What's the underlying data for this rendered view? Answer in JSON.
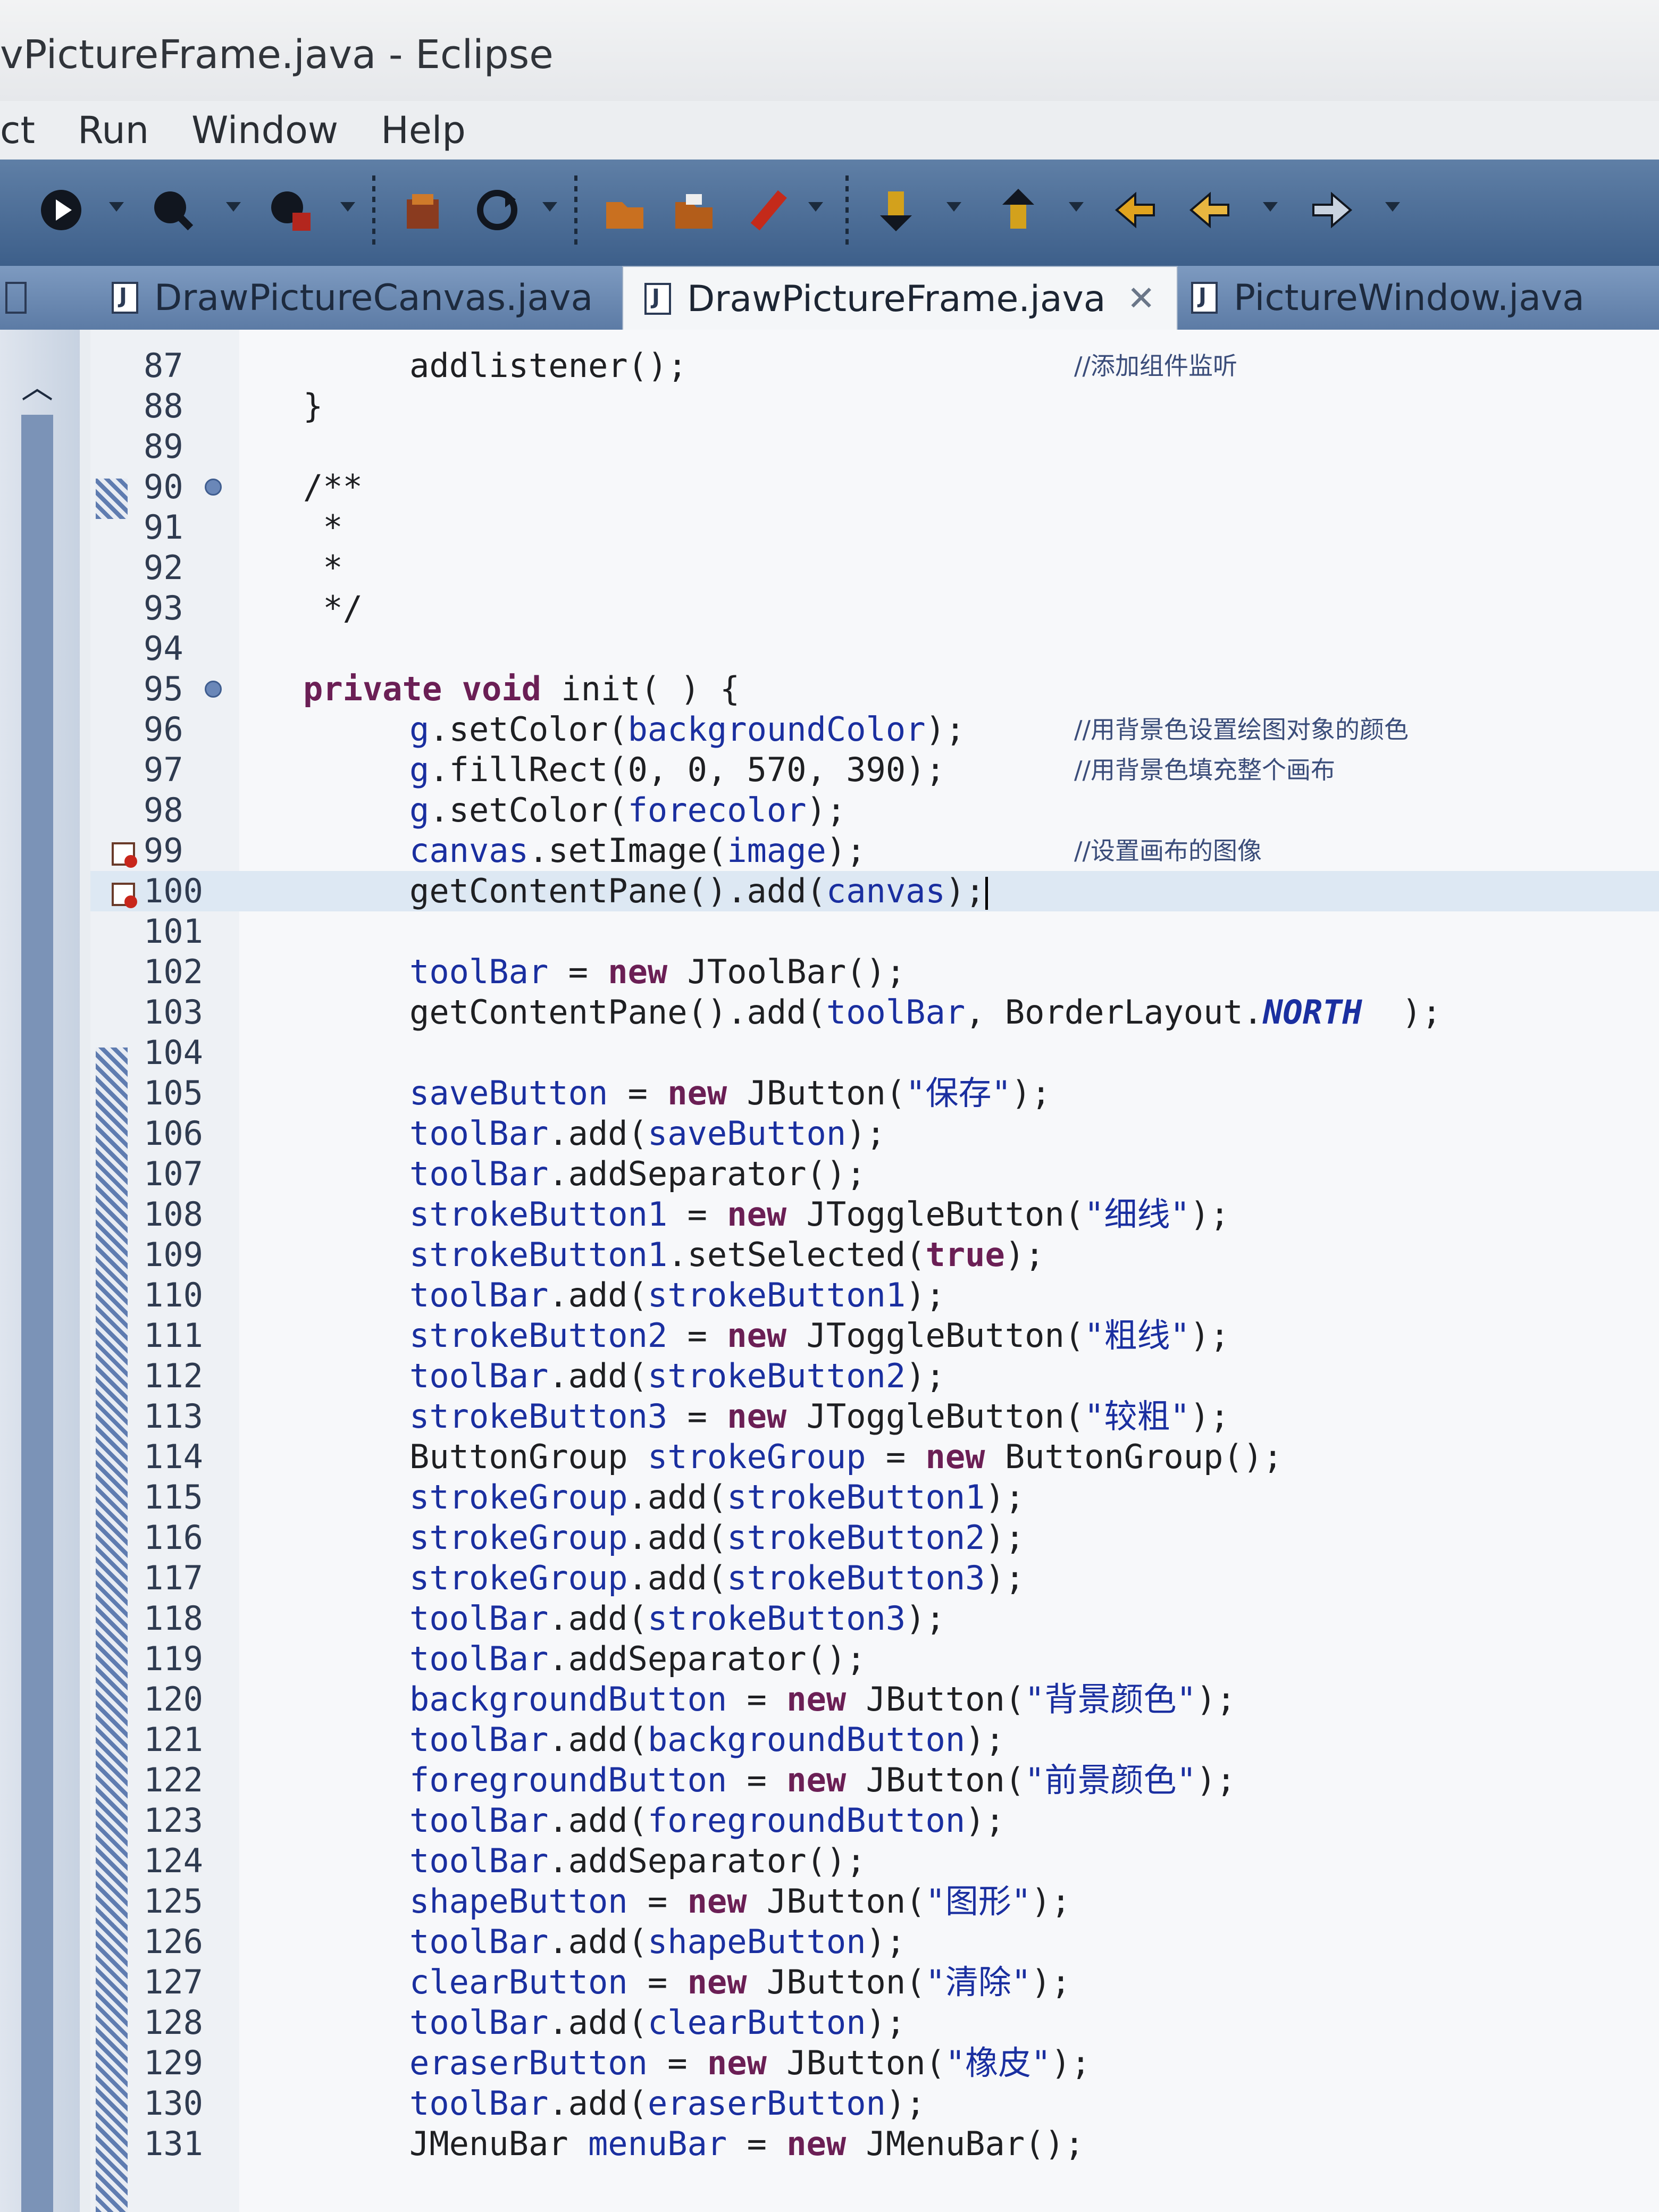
{
  "window": {
    "title": "vPictureFrame.java - Eclipse"
  },
  "menu": {
    "items": [
      "ct",
      "Run",
      "Window",
      "Help"
    ]
  },
  "toolbar": {
    "icons": [
      "debug-icon",
      "run-icon",
      "search-icon",
      "external-tools-icon",
      "new-package-icon",
      "refresh-icon",
      "open-type-icon",
      "open-task-icon",
      "edit-icon",
      "next-annotation-icon",
      "previous-annotation-icon",
      "last-edit-icon",
      "back-icon",
      "forward-icon"
    ]
  },
  "tabs": [
    {
      "label": "DrawPictureCanvas.java",
      "active": false
    },
    {
      "label": "DrawPictureFrame.java",
      "active": true,
      "close": "✕"
    },
    {
      "label": "PictureWindow.java",
      "active": false
    }
  ],
  "editor": {
    "current_line": "100",
    "lines": [
      {
        "num": "87",
        "indent": 1,
        "code": "addlistener();",
        "comment": "//添加组件监听"
      },
      {
        "num": "88",
        "indent": 0,
        "code": "}",
        "comment": ""
      },
      {
        "num": "89",
        "indent": 0,
        "code": "",
        "comment": ""
      },
      {
        "num": "90",
        "indent": 0,
        "code": "/**",
        "comment": ""
      },
      {
        "num": "91",
        "indent": 0,
        "code": " *",
        "comment": ""
      },
      {
        "num": "92",
        "indent": 0,
        "code": " *",
        "comment": ""
      },
      {
        "num": "93",
        "indent": 0,
        "code": " */",
        "comment": ""
      },
      {
        "num": "94",
        "indent": 0,
        "code": "",
        "comment": ""
      },
      {
        "num": "95",
        "indent": 0,
        "code": "private void init( ) {",
        "comment": ""
      },
      {
        "num": "96",
        "indent": 1,
        "code": "g.setColor(backgroundColor);",
        "comment": "//用背景色设置绘图对象的颜色"
      },
      {
        "num": "97",
        "indent": 1,
        "code": "g.fillRect(0, 0, 570, 390);",
        "comment": "//用背景色填充整个画布"
      },
      {
        "num": "98",
        "indent": 1,
        "code": "g.setColor(forecolor);",
        "comment": ""
      },
      {
        "num": "99",
        "indent": 1,
        "code": "canvas.setImage(image);",
        "comment": "//设置画布的图像"
      },
      {
        "num": "100",
        "indent": 1,
        "code": "getContentPane().add(canvas);",
        "comment": ""
      },
      {
        "num": "101",
        "indent": 1,
        "code": "",
        "comment": ""
      },
      {
        "num": "102",
        "indent": 1,
        "code": "toolBar = new JToolBar();",
        "comment": ""
      },
      {
        "num": "103",
        "indent": 1,
        "code": "getContentPane().add(toolBar, BorderLayout.NORTH  );",
        "comment": ""
      },
      {
        "num": "104",
        "indent": 1,
        "code": "",
        "comment": ""
      },
      {
        "num": "105",
        "indent": 1,
        "code": "saveButton = new JButton(\"保存\");",
        "comment": ""
      },
      {
        "num": "106",
        "indent": 1,
        "code": "toolBar.add(saveButton);",
        "comment": ""
      },
      {
        "num": "107",
        "indent": 1,
        "code": "toolBar.addSeparator();",
        "comment": ""
      },
      {
        "num": "108",
        "indent": 1,
        "code": "strokeButton1 = new JToggleButton(\"细线\");",
        "comment": ""
      },
      {
        "num": "109",
        "indent": 1,
        "code": "strokeButton1.setSelected(true);",
        "comment": ""
      },
      {
        "num": "110",
        "indent": 1,
        "code": "toolBar.add(strokeButton1);",
        "comment": ""
      },
      {
        "num": "111",
        "indent": 1,
        "code": "strokeButton2 = new JToggleButton(\"粗线\");",
        "comment": ""
      },
      {
        "num": "112",
        "indent": 1,
        "code": "toolBar.add(strokeButton2);",
        "comment": ""
      },
      {
        "num": "113",
        "indent": 1,
        "code": "strokeButton3 = new JToggleButton(\"较粗\");",
        "comment": ""
      },
      {
        "num": "114",
        "indent": 1,
        "code": "ButtonGroup strokeGroup = new ButtonGroup();",
        "comment": ""
      },
      {
        "num": "115",
        "indent": 1,
        "code": "strokeGroup.add(strokeButton1);",
        "comment": ""
      },
      {
        "num": "116",
        "indent": 1,
        "code": "strokeGroup.add(strokeButton2);",
        "comment": ""
      },
      {
        "num": "117",
        "indent": 1,
        "code": "strokeGroup.add(strokeButton3);",
        "comment": ""
      },
      {
        "num": "118",
        "indent": 1,
        "code": "toolBar.add(strokeButton3);",
        "comment": ""
      },
      {
        "num": "119",
        "indent": 1,
        "code": "toolBar.addSeparator();",
        "comment": ""
      },
      {
        "num": "120",
        "indent": 1,
        "code": "backgroundButton = new JButton(\"背景颜色\");",
        "comment": ""
      },
      {
        "num": "121",
        "indent": 1,
        "code": "toolBar.add(backgroundButton);",
        "comment": ""
      },
      {
        "num": "122",
        "indent": 1,
        "code": "foregroundButton = new JButton(\"前景颜色\");",
        "comment": ""
      },
      {
        "num": "123",
        "indent": 1,
        "code": "toolBar.add(foregroundButton);",
        "comment": ""
      },
      {
        "num": "124",
        "indent": 1,
        "code": "toolBar.addSeparator();",
        "comment": ""
      },
      {
        "num": "125",
        "indent": 1,
        "code": "shapeButton = new JButton(\"图形\");",
        "comment": ""
      },
      {
        "num": "126",
        "indent": 1,
        "code": "toolBar.add(shapeButton);",
        "comment": ""
      },
      {
        "num": "127",
        "indent": 1,
        "code": "clearButton = new JButton(\"清除\");",
        "comment": ""
      },
      {
        "num": "128",
        "indent": 1,
        "code": "toolBar.add(clearButton);",
        "comment": ""
      },
      {
        "num": "129",
        "indent": 1,
        "code": "eraserButton = new JButton(\"橡皮\");",
        "comment": ""
      },
      {
        "num": "130",
        "indent": 1,
        "code": "toolBar.add(eraserButton);",
        "comment": ""
      },
      {
        "num": "131",
        "indent": 1,
        "code": "JMenuBar menuBar = new JMenuBar();",
        "comment": ""
      }
    ],
    "markers": {
      "fold_lines": [
        "90",
        "95"
      ],
      "error_lines": [
        "99",
        "100"
      ]
    }
  },
  "colors": {
    "keyword": "#6b1f55",
    "field": "#1a2fa0",
    "comment": "#3b4d7a",
    "current_line": "#dde8f3"
  }
}
